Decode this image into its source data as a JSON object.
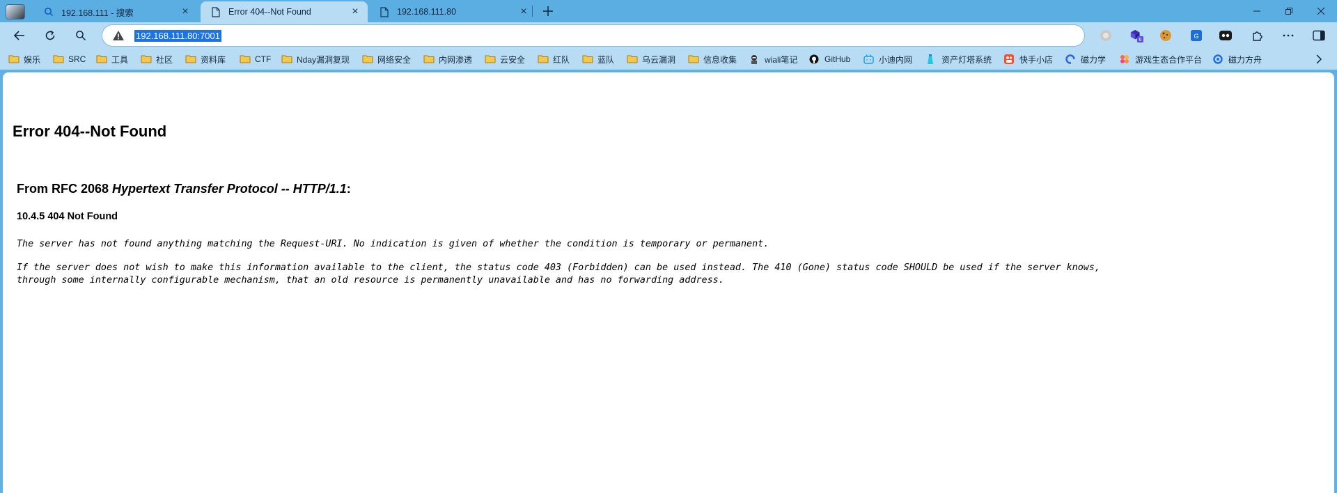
{
  "tabs": [
    {
      "title": "192.168.111 - 搜索",
      "icon": "search-icon",
      "active": false
    },
    {
      "title": "Error 404--Not Found",
      "icon": "page-icon",
      "active": true
    },
    {
      "title": "192.168.111.80",
      "icon": "page-icon",
      "active": false
    }
  ],
  "address": {
    "url": "192.168.111.80:7001",
    "security": "not-secure-warning-icon"
  },
  "bookmarks": [
    {
      "label": "娱乐",
      "icon": "folder-icon"
    },
    {
      "label": "SRC",
      "icon": "folder-icon"
    },
    {
      "label": "工具",
      "icon": "folder-icon"
    },
    {
      "label": "社区",
      "icon": "folder-icon"
    },
    {
      "label": "资料库",
      "icon": "folder-icon"
    },
    {
      "label": "CTF",
      "icon": "folder-icon"
    },
    {
      "label": "Nday漏洞复现",
      "icon": "folder-icon"
    },
    {
      "label": "网络安全",
      "icon": "folder-icon"
    },
    {
      "label": "内网渗透",
      "icon": "folder-icon"
    },
    {
      "label": "云安全",
      "icon": "folder-icon"
    },
    {
      "label": "红队",
      "icon": "folder-icon"
    },
    {
      "label": "蓝队",
      "icon": "folder-icon"
    },
    {
      "label": "乌云漏洞",
      "icon": "folder-icon"
    },
    {
      "label": "信息收集",
      "icon": "folder-icon"
    },
    {
      "label": "wiali笔记",
      "icon": "hacker-icon"
    },
    {
      "label": "GitHub",
      "icon": "github-icon"
    },
    {
      "label": "小迪内网",
      "icon": "bilibili-icon"
    },
    {
      "label": "资产灯塔系统",
      "icon": "lighthouse-icon"
    },
    {
      "label": "快手小店",
      "icon": "kuaishou-icon"
    },
    {
      "label": "磁力学",
      "icon": "magnet-icon"
    },
    {
      "label": "游戏生态合作平台",
      "icon": "game-icon"
    },
    {
      "label": "磁力方舟",
      "icon": "ark-icon"
    }
  ],
  "extensions": {
    "badge_count": "6"
  },
  "page": {
    "heading": "Error 404--Not Found",
    "rfc_prefix": "From RFC 2068 ",
    "rfc_title": "Hypertext Transfer Protocol -- HTTP/1.1",
    "rfc_suffix": ":",
    "status_heading": "10.4.5 404 Not Found",
    "para1": "The server has not found anything matching the Request-URI. No indication is given of whether the condition is temporary or permanent.",
    "para2_line1": "If the server does not wish to make this information available to the client, the status code 403 (Forbidden) can be used instead. The 410 (Gone) status code SHOULD be used if the server knows,",
    "para2_line2": "through some internally configurable mechanism, that an old resource is permanently unavailable and has no forwarding address."
  },
  "colors": {
    "tabstrip": "#5aaee2",
    "toolbar": "#b8dcf4",
    "selection": "#1a73e8",
    "folder": "#f2c94c"
  }
}
